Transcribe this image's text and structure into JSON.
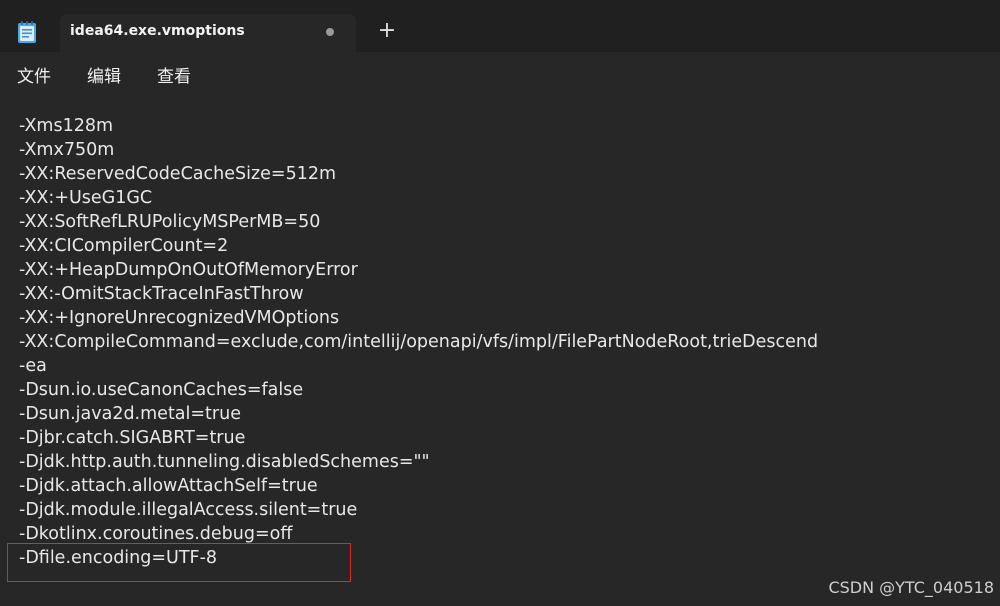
{
  "window": {
    "tab_title": "idea64.exe.vmoptions",
    "new_tab_symbol": "+"
  },
  "menu": {
    "file": "文件",
    "edit": "编辑",
    "view": "查看"
  },
  "editor": {
    "lines": [
      "-Xms128m",
      "-Xmx750m",
      "-XX:ReservedCodeCacheSize=512m",
      "-XX:+UseG1GC",
      "-XX:SoftRefLRUPolicyMSPerMB=50",
      "-XX:CICompilerCount=2",
      "-XX:+HeapDumpOnOutOfMemoryError",
      "-XX:-OmitStackTraceInFastThrow",
      "-XX:+IgnoreUnrecognizedVMOptions",
      "-XX:CompileCommand=exclude,com/intellij/openapi/vfs/impl/FilePartNodeRoot,trieDescend",
      "-ea",
      "-Dsun.io.useCanonCaches=false",
      "-Dsun.java2d.metal=true",
      "-Djbr.catch.SIGABRT=true",
      "-Djdk.http.auth.tunneling.disabledSchemes=\"\"",
      "-Djdk.attach.allowAttachSelf=true",
      "-Djdk.module.illegalAccess.silent=true",
      "-Dkotlinx.coroutines.debug=off",
      "-Dfile.encoding=UTF-8"
    ]
  },
  "watermark": "CSDN @YTC_040518",
  "colors": {
    "highlight": "#e02a2a",
    "background": "#272727",
    "titlebar": "#202020"
  }
}
